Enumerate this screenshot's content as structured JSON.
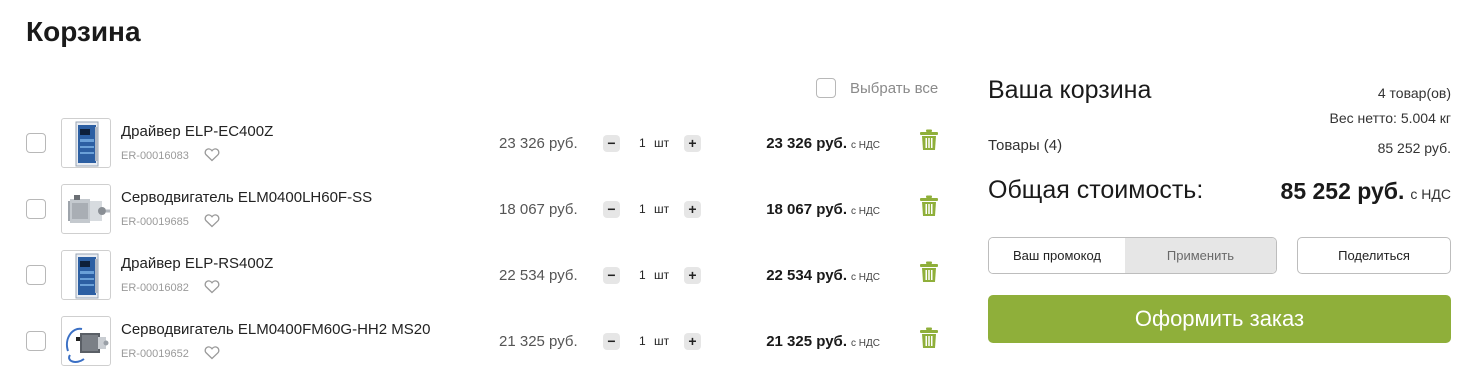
{
  "page": {
    "title": "Корзина"
  },
  "select_all": {
    "label": "Выбрать все"
  },
  "items": [
    {
      "name": "Драйвер ELP-EC400Z",
      "sku": "ER-00016083",
      "unit_price": "23 326 руб.",
      "quantity": "1",
      "unit": "шт",
      "total": "23 326 руб.",
      "vat": "с НДС",
      "image": "servo-driver-image"
    },
    {
      "name": "Серводвигатель ELM0400LH60F-SS",
      "sku": "ER-00019685",
      "unit_price": "18 067 руб.",
      "quantity": "1",
      "unit": "шт",
      "total": "18 067 руб.",
      "vat": "с НДС",
      "image": "servo-motor-image"
    },
    {
      "name": "Драйвер ELP-RS400Z",
      "sku": "ER-00016082",
      "unit_price": "22 534 руб.",
      "quantity": "1",
      "unit": "шт",
      "total": "22 534 руб.",
      "vat": "с НДС",
      "image": "servo-driver-image"
    },
    {
      "name": "Серводвигатель ELM0400FM60G-HH2 MS20",
      "sku": "ER-00019652",
      "unit_price": "21 325 руб.",
      "quantity": "1",
      "unit": "шт",
      "total": "21 325 руб.",
      "vat": "с НДС",
      "image": "servo-motor-cable-image"
    }
  ],
  "controls": {
    "minus": "−",
    "plus": "+"
  },
  "summary": {
    "title": "Ваша корзина",
    "item_count": "4 товар(ов)",
    "net_weight": "Вес нетто: 5.004 кг",
    "goods_label": "Товары (4)",
    "goods_value": "85 252 руб.",
    "total_label": "Общая стоимость:",
    "total_value": "85 252 руб.",
    "total_vat": "с НДС",
    "promo_placeholder": "Ваш промокод",
    "apply_label": "Применить",
    "share_label": "Поделиться",
    "checkout_label": "Оформить заказ"
  },
  "colors": {
    "accent": "#8faf3a",
    "trash": "#8faf3a",
    "text": "#1a1a1a",
    "muted": "#9a9a9a"
  }
}
